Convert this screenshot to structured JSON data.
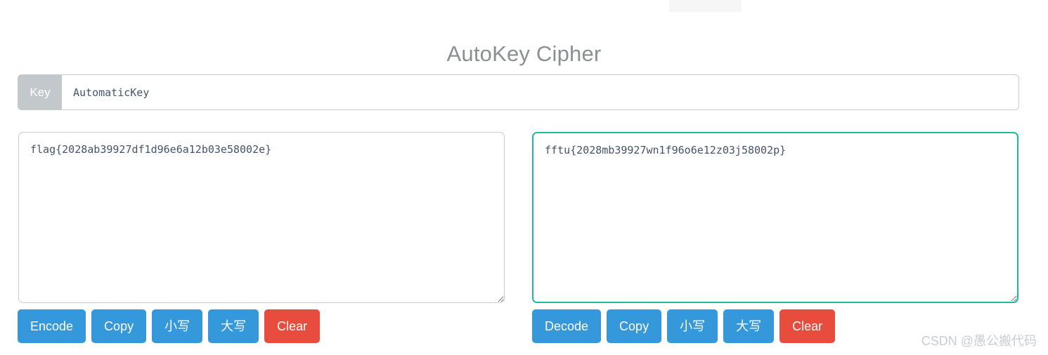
{
  "page": {
    "title": "AutoKey Cipher",
    "background_color": "#ffffff",
    "title_color": "#8a8f94"
  },
  "colors": {
    "primary_button": "#3498db",
    "danger_button": "#e74c3c",
    "focus_border": "#1abc9c",
    "idle_border": "#c7ccd1",
    "addon_background": "#c3c8cd"
  },
  "key_field": {
    "addon_label": "Key",
    "value": "AutomaticKey",
    "placeholder": "Key"
  },
  "panels": {
    "left": {
      "textarea": {
        "value": "flag{2028ab39927df1d96e6a12b03e58002e}",
        "placeholder": ""
      },
      "buttons": [
        {
          "label": "Encode",
          "name": "encode-button",
          "style": "primary"
        },
        {
          "label": "Copy",
          "name": "copy-button-left",
          "style": "primary"
        },
        {
          "label": "小写",
          "name": "lowercase-button-left",
          "style": "primary"
        },
        {
          "label": "大写",
          "name": "uppercase-button-left",
          "style": "primary"
        },
        {
          "label": "Clear",
          "name": "clear-button-left",
          "style": "danger"
        }
      ]
    },
    "right": {
      "textarea": {
        "value": "fftu{2028mb39927wn1f96o6e12z03j58002p}",
        "placeholder": ""
      },
      "buttons": [
        {
          "label": "Decode",
          "name": "decode-button",
          "style": "primary"
        },
        {
          "label": "Copy",
          "name": "copy-button-right",
          "style": "primary"
        },
        {
          "label": "小写",
          "name": "lowercase-button-right",
          "style": "primary"
        },
        {
          "label": "大写",
          "name": "uppercase-button-right",
          "style": "primary"
        },
        {
          "label": "Clear",
          "name": "clear-button-right",
          "style": "danger"
        }
      ]
    }
  },
  "watermark": {
    "text": "CSDN @愚公搬代码"
  }
}
